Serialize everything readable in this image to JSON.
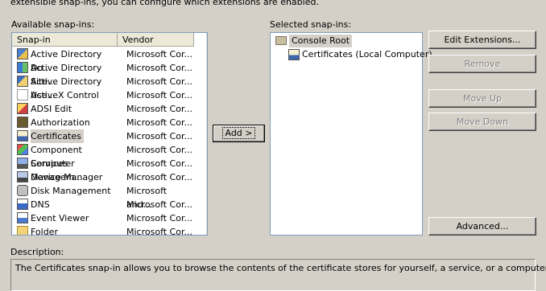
{
  "intro_text": "extensible snap-ins, you can configure which extensions are enabled.",
  "available": {
    "label": "Available snap-ins:",
    "columns": {
      "snapin": "Snap-in",
      "vendor": "Vendor"
    },
    "rows": [
      {
        "name": "Active Directory Do...",
        "vendor": "Microsoft Cor...",
        "icon": "active-directory-domains-icon"
      },
      {
        "name": "Active Directory Site...",
        "vendor": "Microsoft Cor...",
        "icon": "active-directory-sites-icon"
      },
      {
        "name": "Active Directory Use...",
        "vendor": "Microsoft Cor...",
        "icon": "active-directory-users-icon"
      },
      {
        "name": "ActiveX Control",
        "vendor": "Microsoft Cor...",
        "icon": "activex-control-icon"
      },
      {
        "name": "ADSI Edit",
        "vendor": "Microsoft Cor...",
        "icon": "adsi-edit-icon"
      },
      {
        "name": "Authorization Manager",
        "vendor": "Microsoft Cor...",
        "icon": "authorization-manager-icon"
      },
      {
        "name": "Certificates",
        "vendor": "Microsoft Cor...",
        "icon": "certificates-icon"
      },
      {
        "name": "Component Services",
        "vendor": "Microsoft Cor...",
        "icon": "component-services-icon"
      },
      {
        "name": "Computer Managem...",
        "vendor": "Microsoft Cor...",
        "icon": "computer-management-icon"
      },
      {
        "name": "Device Manager",
        "vendor": "Microsoft Cor...",
        "icon": "device-manager-icon"
      },
      {
        "name": "Disk Management",
        "vendor": "Microsoft and...",
        "icon": "disk-management-icon"
      },
      {
        "name": "DNS",
        "vendor": "Microsoft Cor...",
        "icon": "dns-icon"
      },
      {
        "name": "Event Viewer",
        "vendor": "Microsoft Cor...",
        "icon": "event-viewer-icon"
      },
      {
        "name": "Folder",
        "vendor": "Microsoft Cor...",
        "icon": "folder-icon"
      }
    ]
  },
  "add_button": "Add >",
  "selected": {
    "label": "Selected snap-ins:",
    "root": "Console Root",
    "child": "Certificates (Local Computer)"
  },
  "buttons": {
    "edit_extensions": "Edit Extensions...",
    "remove": "Remove",
    "move_up": "Move Up",
    "move_down": "Move Down",
    "advanced": "Advanced..."
  },
  "description": {
    "label": "Description:",
    "text": "The Certificates snap-in allows you to browse the contents of the certificate stores for yourself, a service, or a computer."
  }
}
